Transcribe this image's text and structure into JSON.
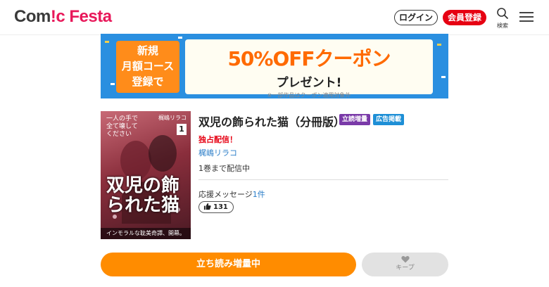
{
  "header": {
    "logo_prefix": "Com",
    "logo_accent": "!c",
    "logo_suffix": " Festa",
    "login_label": "ログイン",
    "register_label": "会員登録",
    "search_label": "検索"
  },
  "banner": {
    "left_text": "新規\n月額コース\n登録で",
    "main_text": "50%OFFクーポン",
    "sub_text": "プレゼント!",
    "note": "※一部作品はクーポン適用対象外"
  },
  "book": {
    "title": "双児の飾られた猫（分冊版）",
    "badges": [
      "立読増量",
      "広告掲載"
    ],
    "exclusive": "独占配信！",
    "author": "梶嶋リラコ",
    "delivery": "1巻まで配信中",
    "cheer_label": "応援メッセージ",
    "cheer_count": "1件",
    "likes": "131"
  },
  "cover": {
    "tagline": "一人の手で\n全て壊して\nください",
    "author": "梶嶋リラコ",
    "volume": "1",
    "title": "双児の飾られた猫",
    "bottom_text": "インモラルな耽美奇譚、開幕。"
  },
  "actions": {
    "read_label": "立ち読み増量中",
    "keep_label": "キープ"
  },
  "colors": {
    "brand_red": "#e60012",
    "accent_orange": "#ff8c00",
    "link_blue": "#2a7dc8",
    "badge_purple": "#7a3aa8",
    "badge_blue": "#1e8fd6"
  }
}
